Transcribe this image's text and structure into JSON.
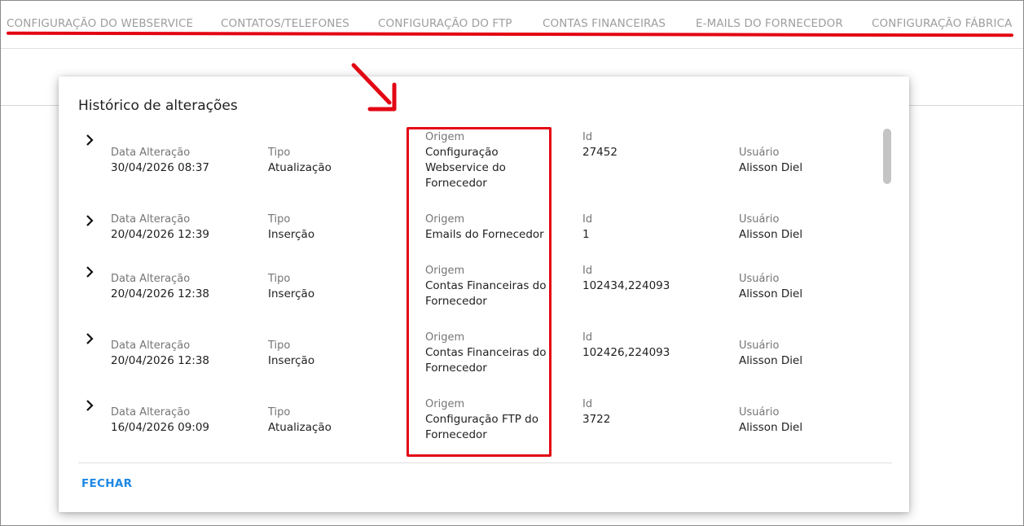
{
  "tabs": [
    {
      "label": "CONFIGURAÇÃO DO WEBSERVICE"
    },
    {
      "label": "CONTATOS/TELEFONES"
    },
    {
      "label": "CONFIGURAÇÃO DO FTP"
    },
    {
      "label": "CONTAS FINANCEIRAS"
    },
    {
      "label": "E-MAILS DO FORNECEDOR"
    },
    {
      "label": "CONFIGURAÇÃO FÁBRICA"
    }
  ],
  "dialog": {
    "title": "Histórico de alterações",
    "close_label": "FECHAR",
    "columns": {
      "date": "Data Alteração",
      "type": "Tipo",
      "origin": "Origem",
      "id": "Id",
      "user": "Usuário"
    },
    "rows": [
      {
        "date": "30/04/2026 08:37",
        "type": "Atualização",
        "origin": "Configuração Webservice do Fornecedor",
        "id": "27452",
        "user": "Alisson Diel"
      },
      {
        "date": "20/04/2026 12:39",
        "type": "Inserção",
        "origin": "Emails do Fornecedor",
        "id": "1",
        "user": "Alisson Diel"
      },
      {
        "date": "20/04/2026 12:38",
        "type": "Inserção",
        "origin": "Contas Financeiras do Fornecedor",
        "id": "102434,224093",
        "user": "Alisson Diel"
      },
      {
        "date": "20/04/2026 12:38",
        "type": "Inserção",
        "origin": "Contas Financeiras do Fornecedor",
        "id": "102426,224093",
        "user": "Alisson Diel"
      },
      {
        "date": "16/04/2026 09:09",
        "type": "Atualização",
        "origin": "Configuração FTP do Fornecedor",
        "id": "3722",
        "user": "Alisson Diel"
      }
    ]
  },
  "colors": {
    "accent": "#1e88e5",
    "annotation": "#e30613",
    "tab_text": "#9e9e9e"
  }
}
